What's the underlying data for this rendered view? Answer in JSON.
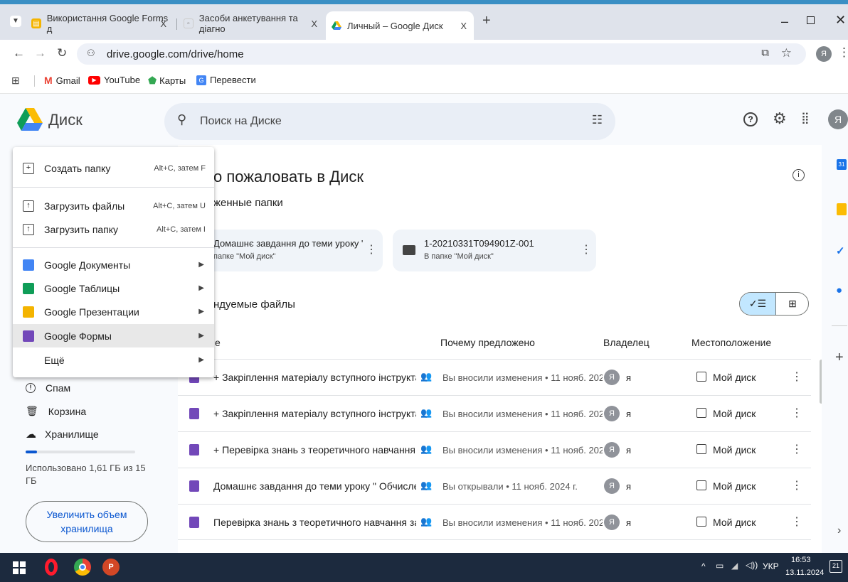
{
  "browser": {
    "tabs": [
      {
        "label": "Використання Google Forms д",
        "close": "X"
      },
      {
        "label": "Засоби анкетування та діагно",
        "close": "X"
      },
      {
        "label": "Личный – Google Диск",
        "close": "X"
      }
    ],
    "new_tab": "+",
    "url": "drive.google.com/drive/home",
    "profile": "Я",
    "bookmarks": [
      "Gmail",
      "YouTube",
      "Карты",
      "Перевести"
    ]
  },
  "drive": {
    "logo_text": "Диск",
    "search_placeholder": "Поиск на Диске",
    "avatar": "Я",
    "welcome": "о пожаловать в Диск",
    "suggested_folders_title": "женные папки",
    "folders": [
      {
        "name": "Домашнє завдання до теми уроку \" ...",
        "location": "папке \"Мой диск\""
      },
      {
        "name": "1-20210331T094901Z-001",
        "location": "В папке \"Мой диск\""
      }
    ],
    "suggested_files_title": "ндуемые файлы",
    "view_toggle": "✓☰",
    "columns": {
      "name": "е",
      "reason": "Почему предложено",
      "owner": "Владелец",
      "location": "Местоположение"
    }
  },
  "menu": {
    "items": [
      {
        "label": "Создать папку",
        "shortcut": "Alt+C, затем F"
      },
      {
        "label": "Загрузить файлы",
        "shortcut": "Alt+C, затем U"
      },
      {
        "label": "Загрузить папку",
        "shortcut": "Alt+C, затем I"
      },
      {
        "label": "Google Документы",
        "shortcut": ""
      },
      {
        "label": "Google Таблицы",
        "shortcut": ""
      },
      {
        "label": "Google Презентации",
        "shortcut": ""
      },
      {
        "label": "Google Формы",
        "shortcut": ""
      },
      {
        "label": "Ещё",
        "shortcut": ""
      }
    ]
  },
  "sidebar": {
    "items": [
      "Спам",
      "Корзина",
      "Хранилище"
    ],
    "storage_text": "Использовано 1,61 ГБ из 15 ГБ",
    "storage_fraction": 0.107,
    "upgrade_button": "Увеличить объем хранилища"
  },
  "files": [
    {
      "name": "+ Закріплення матеріалу вступного інструкта...",
      "reason": "Вы вносили изменения • 11 нояб. 202...",
      "owner_avatar": "Я",
      "owner": "я",
      "location": "Мой диск"
    },
    {
      "name": "+ Закріплення матеріалу вступного інструкта...",
      "reason": "Вы вносили изменения • 11 нояб. 202...",
      "owner_avatar": "Я",
      "owner": "я",
      "location": "Мой диск"
    },
    {
      "name": "+ Перевірка знань з теоретичного навчання з...",
      "reason": "Вы вносили изменения • 11 нояб. 202...",
      "owner_avatar": "Я",
      "owner": "я",
      "location": "Мой диск"
    },
    {
      "name": "Домашнє завдання до теми уроку \" Обчисле...",
      "reason": "Вы открывали • 11 нояб. 2024 г.",
      "owner_avatar": "Я",
      "owner": "я",
      "location": "Мой диск"
    },
    {
      "name": "Перевірка знань з теоретичного навчання за ...",
      "reason": "Вы вносили изменения • 11 нояб. 202...",
      "owner_avatar": "Я",
      "owner": "я",
      "location": "Мой диск"
    }
  ],
  "taskbar": {
    "lang": "УКР",
    "time": "16:53",
    "date": "13.11.2024",
    "notif": "21"
  }
}
